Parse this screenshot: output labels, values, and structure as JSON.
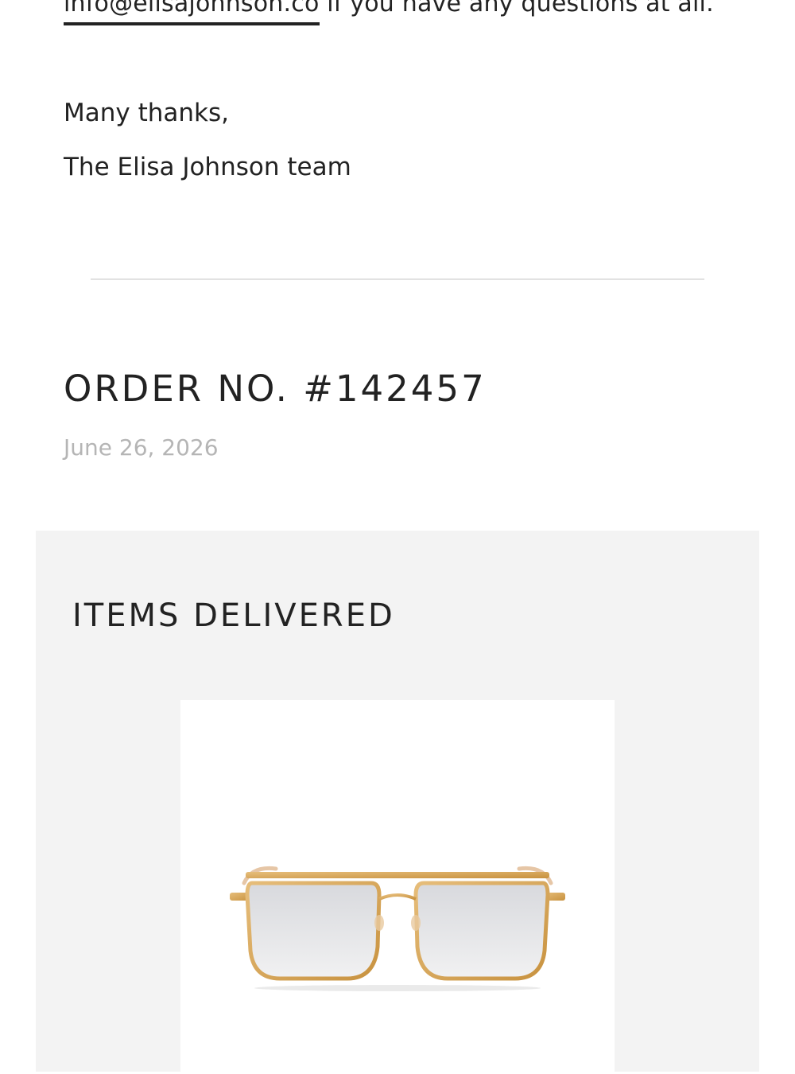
{
  "contact": {
    "email": "info@elisajohnson.co",
    "suffix": " if you have any questions at all."
  },
  "signoff": {
    "thanks": "Many thanks,",
    "team": "The Elisa Johnson team"
  },
  "order": {
    "title": "ORDER NO. #142457",
    "date": "June 26, 2026"
  },
  "items": {
    "title": "ITEMS DELIVERED",
    "products": [
      {
        "image_icon": "aviator-sunglasses-gold-frame"
      }
    ]
  },
  "colors": {
    "text": "#222222",
    "muted": "#b5b5b5",
    "panel": "#f3f3f3",
    "divider": "#e2e2e2",
    "gold": "#d4a45c"
  }
}
